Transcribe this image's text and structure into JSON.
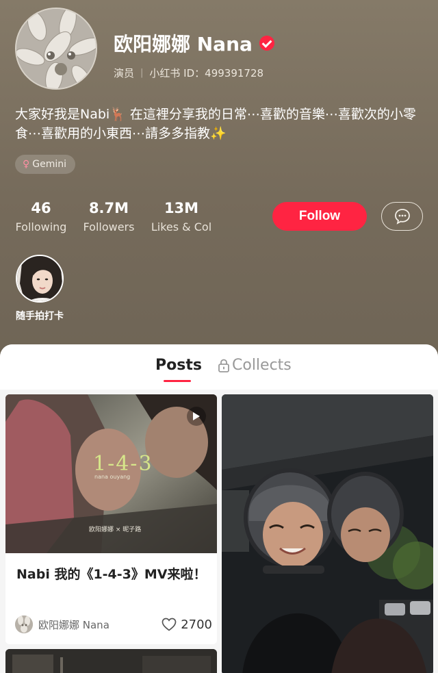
{
  "profile": {
    "name": "欧阳娜娜 Nana",
    "role": "演员",
    "id_label": "小红书 ID：499391728",
    "bio": "大家好我是Nabi🦌 在這裡分享我的日常⋯喜歡的音樂⋯喜歡次的小零食⋯喜歡用的小東西⋯請多多指教✨",
    "tag": "Gemini",
    "tag_icon": "female-symbol"
  },
  "stats": [
    {
      "value": "46",
      "label": "Following"
    },
    {
      "value": "8.7M",
      "label": "Followers"
    },
    {
      "value": "13M",
      "label": "Likes & Col"
    }
  ],
  "actions": {
    "follow_label": "Follow",
    "message_icon": "chat-bubble-icon"
  },
  "highlight": {
    "label": "随手拍打卡"
  },
  "tabs": {
    "posts": "Posts",
    "collects": "Collects"
  },
  "posts": [
    {
      "title": "Nabi 我的《1-4-3》MV来啦！",
      "author": "欧阳娜娜 Nana",
      "likes": "2700",
      "type": "video",
      "overlay_title": "1-4-3",
      "overlay_sub": "nana ouyang",
      "overlay_credit": "欧阳娜娜 × 昵子路"
    },
    {
      "type": "image"
    },
    {
      "type": "image"
    }
  ],
  "colors": {
    "accent": "#ff2442",
    "header_bg": "#766b5b"
  }
}
